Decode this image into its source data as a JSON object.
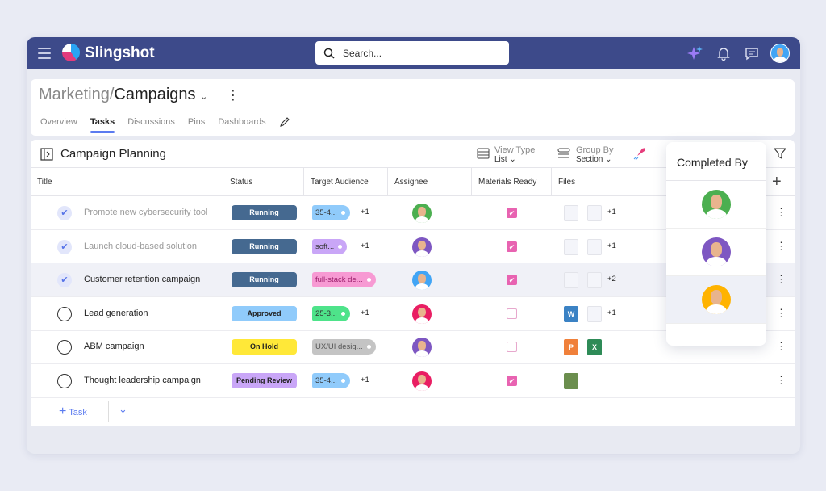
{
  "app": {
    "name": "Slingshot",
    "search_placeholder": "Search..."
  },
  "breadcrumb": {
    "parent": "Marketing",
    "separator": "/",
    "current": "Campaigns"
  },
  "tabs": [
    "Overview",
    "Tasks",
    "Discussions",
    "Pins",
    "Dashboards"
  ],
  "active_tab": "Tasks",
  "project": {
    "title": "Campaign Planning",
    "view_type_label": "View Type",
    "view_type_value": "List",
    "group_by_label": "Group By",
    "group_by_value": "Section"
  },
  "columns": [
    "Title",
    "Status",
    "Target Audience",
    "Assignee",
    "Materials Ready",
    "Files"
  ],
  "rows": [
    {
      "title": "Promote new cybersecurity tool",
      "done": true,
      "status": "Running",
      "status_color": "#456990",
      "audience": "35-4...",
      "aud_color": "#90cbfb",
      "more_aud": "+1",
      "assignee_bg": "#4caf50",
      "materials": true,
      "files": [
        "thumb",
        "thumb"
      ],
      "more_files": "+1"
    },
    {
      "title": "Launch cloud-based solution",
      "done": true,
      "status": "Running",
      "status_color": "#456990",
      "audience": "soft...",
      "aud_color": "#c9a6f7",
      "more_aud": "+1",
      "assignee_bg": "#7e57c2",
      "materials": true,
      "files": [
        "thumb",
        "thumb"
      ],
      "more_files": "+1"
    },
    {
      "title": "Customer retention campaign",
      "done": true,
      "status": "Running",
      "status_color": "#456990",
      "audience": "full-stack de...",
      "aud_color": "#f79ad3",
      "more_aud": "",
      "assignee_bg": "#42a5f5",
      "materials": true,
      "files": [
        "thumb",
        "thumb"
      ],
      "more_files": "+2"
    },
    {
      "title": "Lead generation",
      "done": false,
      "status": "Approved",
      "status_color": "#90cbfb",
      "audience": "25-3...",
      "aud_color": "#4ee38a",
      "more_aud": "+1",
      "assignee_bg": "#e91e63",
      "materials": false,
      "files": [
        "W",
        "thumb"
      ],
      "more_files": "+1"
    },
    {
      "title": "ABM campaign",
      "done": false,
      "status": "On Hold",
      "status_color": "#ffe838",
      "audience": "UX/UI desig...",
      "aud_color": "#c4c4c4",
      "more_aud": "",
      "assignee_bg": "#7e57c2",
      "materials": false,
      "files": [
        "P",
        "X"
      ],
      "more_files": ""
    },
    {
      "title": "Thought leadership campaign",
      "done": false,
      "status": "Pending Review",
      "status_color": "#c9a6f7",
      "audience": "35-4...",
      "aud_color": "#90cbfb",
      "more_aud": "+1",
      "assignee_bg": "#e91e63",
      "materials": true,
      "files": [
        "Z"
      ],
      "more_files": ""
    }
  ],
  "add_task_label": "Task",
  "popup": {
    "title": "Completed By",
    "avatars": [
      "#4caf50",
      "#7e57c2",
      "#ffb300"
    ]
  }
}
